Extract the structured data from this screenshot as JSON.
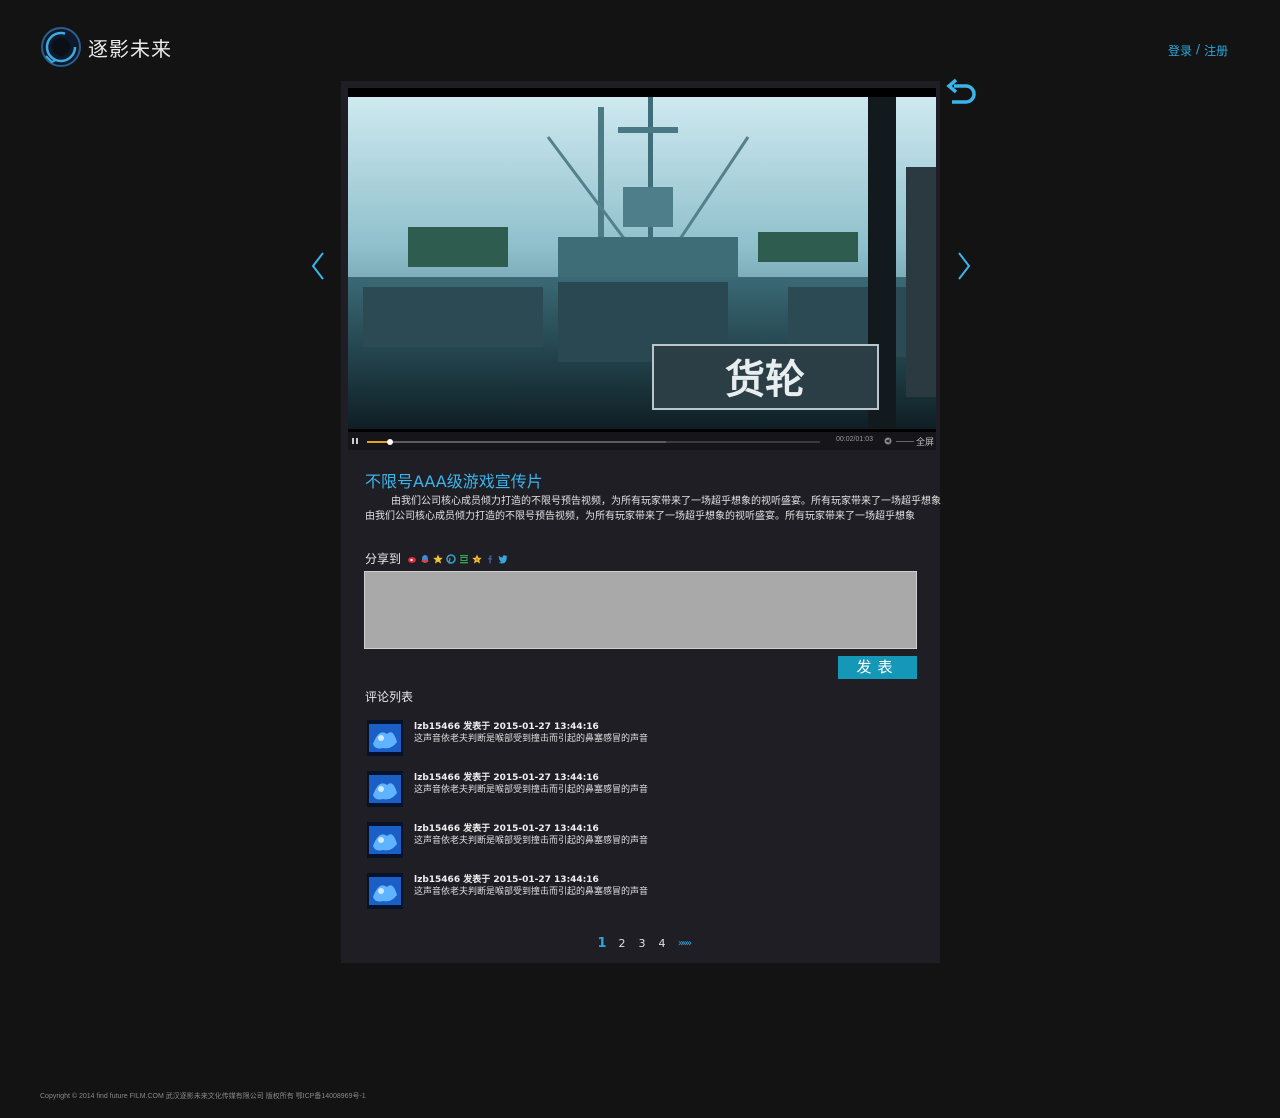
{
  "brand": {
    "name": "逐影未来",
    "accent": "#2aa7dd"
  },
  "auth": {
    "login": "登录",
    "sep": "/",
    "register": "注册"
  },
  "video": {
    "caption": "货轮",
    "time_current": "00:02",
    "time_total": "01:03",
    "time_sep": "/",
    "progress": 0.05,
    "buffered": 0.66,
    "fullscreen_label": "全屏"
  },
  "post": {
    "title": "不限号AAA级游戏宣传片",
    "desc_line1": "由我们公司核心成员倾力打造的不限号预告视频，为所有玩家带来了一场超乎想象的视听盛宴。所有玩家带来了一场超乎想象",
    "desc_line2": "由我们公司核心成员倾力打造的不限号预告视频，为所有玩家带来了一场超乎想象的视听盛宴。所有玩家带来了一场超乎想象"
  },
  "share": {
    "label": "分享到",
    "icons": [
      "weibo-icon",
      "qq-icon",
      "qzone-icon",
      "pinterest-icon",
      "douban-icon",
      "star-icon",
      "facebook-icon",
      "twitter-icon"
    ]
  },
  "comment_form": {
    "value": "",
    "submit_label": "发表"
  },
  "comments": {
    "title": "评论列表",
    "items": [
      {
        "meta": "lzb15466 发表于 2015-01-27 13:44:16",
        "text": "这声音依老夫判断是喉部受到撞击而引起的鼻塞感冒的声音"
      },
      {
        "meta": "lzb15466 发表于 2015-01-27 13:44:16",
        "text": "这声音依老夫判断是喉部受到撞击而引起的鼻塞感冒的声音"
      },
      {
        "meta": "lzb15466 发表于 2015-01-27 13:44:16",
        "text": "这声音依老夫判断是喉部受到撞击而引起的鼻塞感冒的声音"
      },
      {
        "meta": "lzb15466 发表于 2015-01-27 13:44:16",
        "text": "这声音依老夫判断是喉部受到撞击而引起的鼻塞感冒的声音"
      }
    ]
  },
  "pager": {
    "pages": [
      "1",
      "2",
      "3",
      "4"
    ],
    "active": "1",
    "next": "»»»"
  },
  "footer": {
    "text": "Copyright © 2014 find future FILM.COM 武汉逐影未来文化传媒有限公司 版权所有 鄂ICP备14008969号-1"
  }
}
